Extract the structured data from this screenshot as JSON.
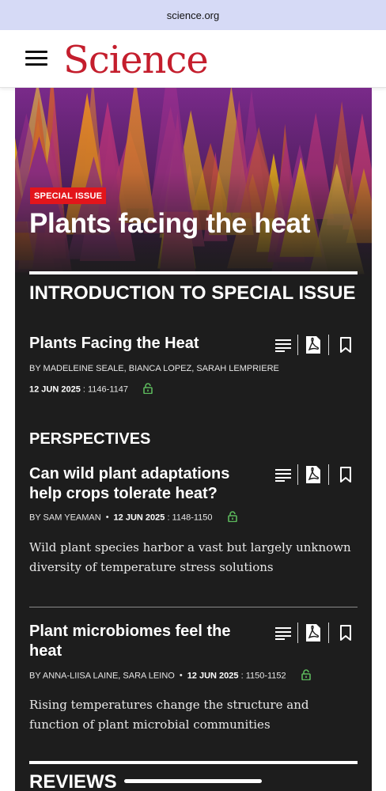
{
  "browser": {
    "url": "science.org"
  },
  "site": {
    "logo": "Science"
  },
  "hero": {
    "badge": "SPECIAL ISSUE",
    "title": "Plants facing the heat"
  },
  "sections": {
    "intro": "INTRODUCTION TO SPECIAL ISSUE",
    "perspectives": "PERSPECTIVES",
    "reviews": "REVIEWS"
  },
  "articles": [
    {
      "title": "Plants Facing the Heat",
      "authors": "BY MADELEINE SEALE, BIANCA LOPEZ, SARAH LEMPRIERE",
      "date": "12 JUN 2025",
      "pages": ": 1146-1147",
      "description": ""
    },
    {
      "title": "Can wild plant adaptations help crops tolerate heat?",
      "authors": "BY SAM YEAMAN",
      "date": "12 JUN 2025",
      "pages": ": 1148-1150",
      "description": "Wild plant species harbor a vast but largely unknown diversity of temperature stress solutions"
    },
    {
      "title": "Plant microbiomes feel the heat",
      "authors": "BY ANNA-LIISA LAINE, SARA LEINO",
      "date": "12 JUN 2025",
      "pages": ": 1150-1152",
      "description": "Rising temperatures change the structure and function of plant microbial communities"
    }
  ],
  "icons": {
    "abstract": "abstract-lines-icon",
    "pdf": "pdf-icon",
    "bookmark": "bookmark-icon",
    "lock": "open-access-lock-icon"
  },
  "colors": {
    "brand": "#c41e2d",
    "badge": "#e3151b",
    "card": "#1d1d1d",
    "access": "#5cb85c",
    "urlbar": "#d6daf6"
  }
}
